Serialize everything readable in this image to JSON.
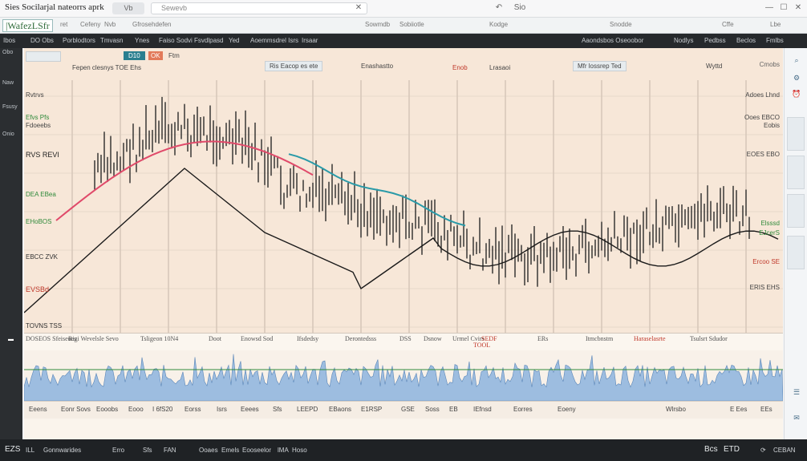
{
  "title_bar": {
    "title": "Sies Socilarjal nateorrs aprk",
    "tab_label": "Vb",
    "url_text": "Sewevb",
    "back_icon": "back-arrow-icon",
    "nav_text": "Sio",
    "window_min": "—",
    "window_max": "☐",
    "window_close": "✕"
  },
  "toolbar": {
    "brand": "|WafezLSfr",
    "items": [
      "ret",
      "Cefeny",
      "Nvb",
      "Gfrosehdefen",
      "Sowmdb",
      "Sobiiotle",
      "Kodge",
      "Snodde",
      "Cffe",
      "Lbe"
    ]
  },
  "tabs": [
    "Ibos",
    "DO Obs",
    "Porblodtors",
    "Tmvasn",
    "Ynes",
    "Faiso Sodvi",
    "Fsvdlpasd",
    "Yed",
    "Aoemmsdrel Isrs",
    "Irsaar",
    "Aaondsbos Oseoobor",
    "Nodlys",
    "Pedbss",
    "Beclos",
    "Fmlbs"
  ],
  "left_nav": {
    "items": [
      "Obo",
      "Naw",
      "Fsusy",
      "Onio"
    ]
  },
  "chart_controls": {
    "timeframe": "D10",
    "badge": "OK",
    "dropdown": "Ftm",
    "symbol_label": "Fepen clesnys TOE Ehs",
    "indicator_a": "Ris Eacop es ete",
    "indicator_b": "Enashastto",
    "indicator_c": "Enob",
    "indicator_d": "Lrasaoi",
    "indicator_e": "Mfr lossrep Ted",
    "compare": "Wyttd"
  },
  "price_labels_left": [
    {
      "text": "Rvtrvs",
      "color": "#444"
    },
    {
      "text": "Efvs Pfs",
      "color": "#2f8a3a"
    },
    {
      "text": "Fdoeebs",
      "color": "#444"
    },
    {
      "text": "RVS REVI",
      "color": "#222"
    },
    {
      "text": "DEA EBea",
      "color": "#2f8a3a"
    },
    {
      "text": "EHoBOS",
      "color": "#2f8a3a"
    },
    {
      "text": "EBCC ZVK",
      "color": "#333"
    },
    {
      "text": "EVSBd",
      "color": "#c0392b"
    },
    {
      "text": "TOVNS TSS",
      "color": "#333"
    }
  ],
  "price_labels_right": [
    {
      "text": "Cmobs",
      "color": "#666"
    },
    {
      "text": "Adoes Lhnd",
      "color": "#444"
    },
    {
      "text": "Ooes EBCO",
      "color": "#444"
    },
    {
      "text": "Eobis",
      "color": "#444"
    },
    {
      "text": "EOES EBO",
      "color": "#444"
    },
    {
      "text": "Elsssd",
      "color": "#2f8a3a"
    },
    {
      "text": "EJcerS",
      "color": "#2f8a3a"
    },
    {
      "text": "Ercoo SE",
      "color": "#c0392b"
    },
    {
      "text": "ERIS EHS",
      "color": "#444"
    }
  ],
  "info_strip": [
    "DOSEOS Sfeiseues",
    "Rigi Wevelsle Sevo",
    "Tsligeon 10N4",
    "Doot",
    "Enowsd Sod",
    "Ifsdedsy",
    "Derontedsss",
    "DSS",
    "Dsnow",
    "Urmel Cvirs",
    "SEDF",
    "ERs",
    "Itmcbnstm",
    "Haraselasrte",
    "Tsulsrt Sdudor"
  ],
  "info_strip_tag": "TOOL",
  "lower_strip": [
    "Eeens",
    "Eonr Sovs",
    "Eooobs",
    "Eooo",
    "I 6fS20",
    "Eorss",
    "Isrs",
    "Eeees",
    "Sfs",
    "LEEPD",
    "EBaons",
    "E1RSP",
    "GSE",
    "Soss",
    "EB",
    "IEfnsd",
    "Eorres",
    "Eoeny",
    "Wlrsbo",
    "E Ees",
    "EEs"
  ],
  "status_bar": {
    "left": "EZS",
    "items": [
      "ILL",
      "Gonnwarides",
      "Erro",
      "Sfs",
      "FAN",
      "Ooaes",
      "Emels",
      "Eooseelor",
      "lMA",
      "Hoso"
    ],
    "right_a": "Bcs",
    "right_b": "ETD",
    "right_c": "CEBAN"
  },
  "colors": {
    "chart_bg": "#f7e7d8",
    "candles": "#1c1c1c",
    "ma_fast": "#e04a6a",
    "ma_mid": "#2a9aa8",
    "ma_slow": "#1a1a1a",
    "volume": "#9dbde0",
    "grid": "#c4b6a8"
  }
}
